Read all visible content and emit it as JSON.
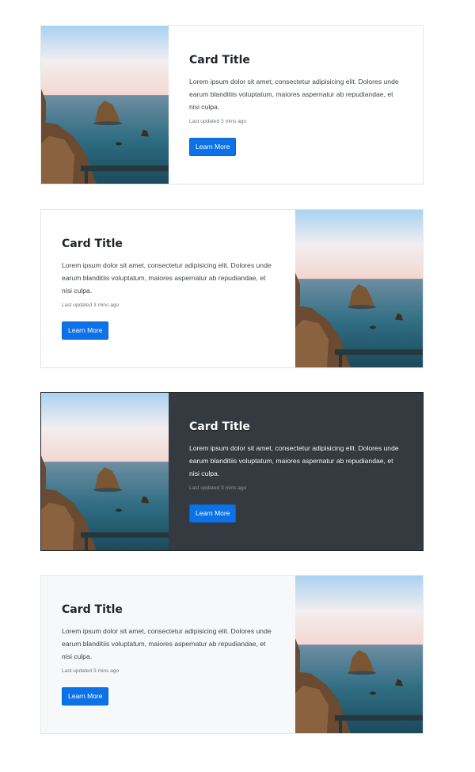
{
  "cards": [
    {
      "title": "Card Title",
      "text": "Lorem ipsum dolor sit amet, consectetur adipisicing elit. Dolores unde earum blanditiis voluptatum, maiores aspernatur ab repudiandae, et nisi culpa.",
      "meta": "Last updated 3 mins ago",
      "button": "Learn More",
      "image": "sea-rock-photo",
      "image_side": "left",
      "theme": "white"
    },
    {
      "title": "Card Title",
      "text": "Lorem ipsum dolor sit amet, consectetur adipisicing elit. Dolores unde earum blanditiis voluptatum, maiores aspernatur ab repudiandae, et nisi culpa.",
      "meta": "Last updated 3 mins ago",
      "button": "Learn More",
      "image": "sea-rock-photo",
      "image_side": "right",
      "theme": "white"
    },
    {
      "title": "Card Title",
      "text": "Lorem ipsum dolor sit amet, consectetur adipisicing elit. Dolores unde earum blanditiis voluptatum, maiores aspernatur ab repudiandae, et nisi culpa.",
      "meta": "Last updated 3 mins ago",
      "button": "Learn More",
      "image": "sea-rock-photo",
      "image_side": "left",
      "theme": "dark"
    },
    {
      "title": "Card Title",
      "text": "Lorem ipsum dolor sit amet, consectetur adipisicing elit. Dolores unde earum blanditiis voluptatum, maiores aspernatur ab repudiandae, et nisi culpa.",
      "meta": "Last updated 3 mins ago",
      "button": "Learn More",
      "image": "sea-rock-photo",
      "image_side": "right",
      "theme": "light"
    }
  ],
  "colors": {
    "button": "#0d72e8",
    "dark_card": "#343a40",
    "light_card": "#f7f8fa",
    "border": "#e3e5e8"
  }
}
